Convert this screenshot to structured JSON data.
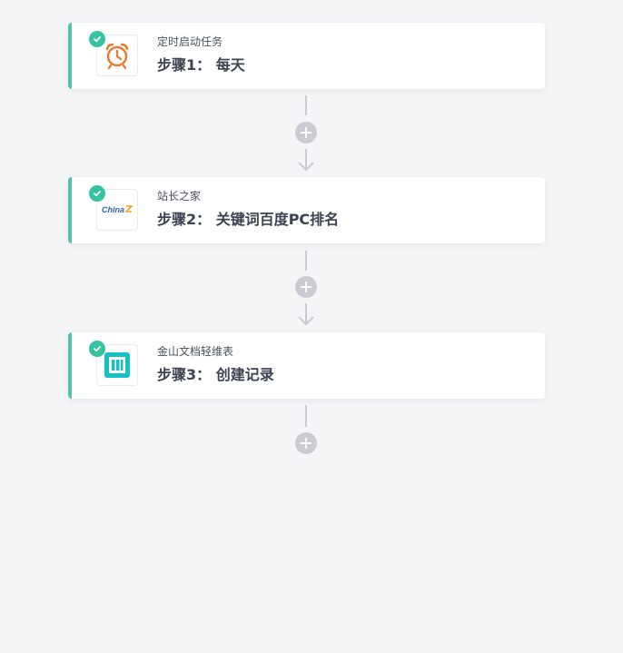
{
  "colors": {
    "accent": "#4dc7a6",
    "check": "#33c3a0",
    "connector": "#c9ccd2",
    "background": "#f4f5f7"
  },
  "steps": [
    {
      "app_name": "定时启动任务",
      "title": "步骤1： 每天",
      "icon": "alarm-clock-icon",
      "status": "completed"
    },
    {
      "app_name": "站长之家",
      "title": "步骤2： 关键词百度PC排名",
      "icon": "chinaz-logo-icon",
      "logo_text": "China",
      "status": "completed"
    },
    {
      "app_name": "金山文档轻维表",
      "title": "步骤3： 创建记录",
      "icon": "kdocs-table-icon",
      "status": "completed"
    }
  ]
}
